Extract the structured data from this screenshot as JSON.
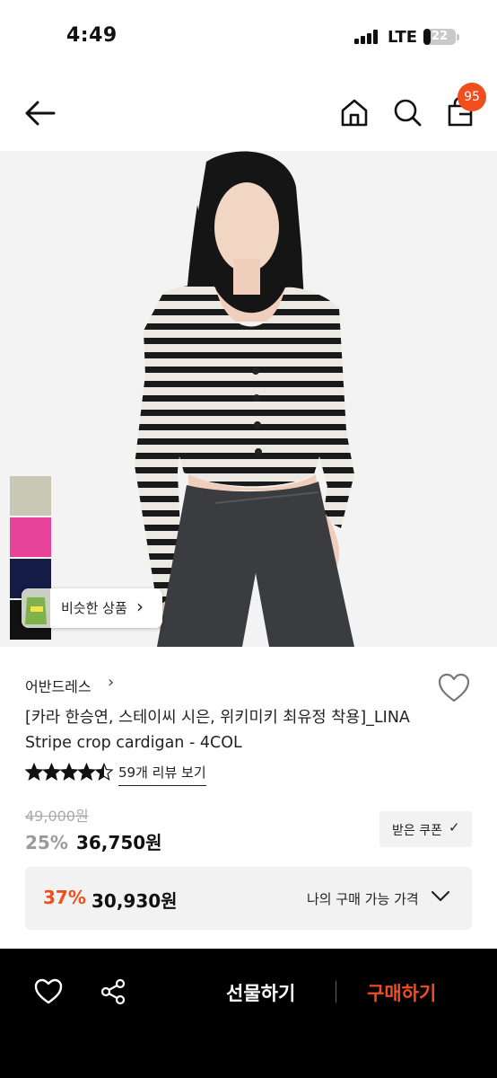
{
  "status_bar": {
    "time": "4:49",
    "network": "LTE",
    "battery_level": "22",
    "battery_fraction": 0.22
  },
  "nav": {
    "icons": [
      "back-arrow-icon",
      "home-icon",
      "search-icon",
      "shopping-bag-icon"
    ],
    "cart_count": "95"
  },
  "hero": {
    "color_swatches": [
      "#c7c9b5",
      "#e8439a",
      "#141b45",
      "#111111"
    ],
    "similar_label": "비슷한 상품",
    "similar_chevron": "›"
  },
  "product": {
    "brand": "어반드레스",
    "brand_chevron": "›",
    "title": "[카라 한승연, 스테이씨 시은, 위키미키 최유정 착용]_LINA Stripe crop cardigan - 4COL",
    "rating": 4.5,
    "review_link": "59개 리뷰 보기",
    "original_price": "49,000원",
    "discount_rate": "25%",
    "sale_price": "36,750원",
    "coupon_label": "받은 쿠폰",
    "coupon_icon": "✓",
    "best": {
      "rate": "37%",
      "price": "30,930원",
      "label": "나의 구매 가능 가격"
    }
  },
  "bottom_bar": {
    "gift_label": "선물하기",
    "buy_label": "구매하기"
  },
  "colors": {
    "accent": "#f04e1d",
    "bottom_bar_bg": "#000000",
    "panel_bg": "#f2f2f2"
  }
}
